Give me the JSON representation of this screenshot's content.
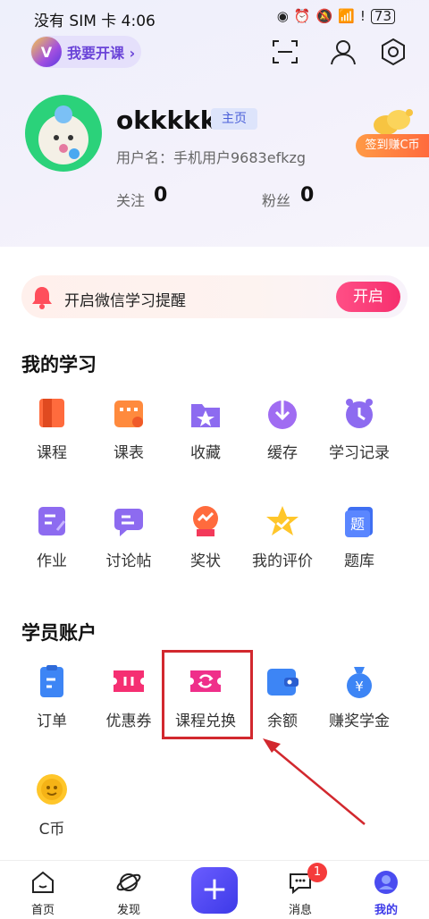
{
  "status_bar": {
    "carrier": "没有 SIM 卡 4:06",
    "battery": "73"
  },
  "header": {
    "teach_label": "我要开课 ›",
    "teach_logo": "V"
  },
  "profile": {
    "username": "okkkkk",
    "home_tag": "主页",
    "user_id": "用户名：手机用户9683efkzg",
    "follow_label": "关注",
    "follow_count": "0",
    "fans_label": "粉丝",
    "fans_count": "0",
    "signin_label": "签到赚C币"
  },
  "reminder": {
    "text": "开启微信学习提醒",
    "button": "开启"
  },
  "my_learning": {
    "title": "我的学习",
    "items": [
      {
        "label": "课程",
        "icon": "book-icon"
      },
      {
        "label": "课表",
        "icon": "calendar-icon"
      },
      {
        "label": "收藏",
        "icon": "star-folder-icon"
      },
      {
        "label": "缓存",
        "icon": "download-icon"
      },
      {
        "label": "学习记录",
        "icon": "clock-icon"
      },
      {
        "label": "作业",
        "icon": "homework-icon"
      },
      {
        "label": "讨论帖",
        "icon": "discussion-icon"
      },
      {
        "label": "奖状",
        "icon": "medal-icon"
      },
      {
        "label": "我的评价",
        "icon": "review-star-icon"
      },
      {
        "label": "题库",
        "icon": "question-bank-icon"
      }
    ]
  },
  "student_account": {
    "title": "学员账户",
    "items": [
      {
        "label": "订单",
        "icon": "order-icon"
      },
      {
        "label": "优惠券",
        "icon": "coupon-icon"
      },
      {
        "label": "课程兑换",
        "icon": "exchange-icon"
      },
      {
        "label": "余额",
        "icon": "wallet-icon"
      },
      {
        "label": "赚奖学金",
        "icon": "money-bag-icon"
      },
      {
        "label": "C币",
        "icon": "coin-icon"
      }
    ]
  },
  "tabbar": {
    "home": "首页",
    "discover": "发现",
    "plus": "+",
    "messages": "消息",
    "messages_badge": "1",
    "mine": "我的"
  },
  "colors": {
    "accent": "#5b3be0",
    "pink": "#f62f6e",
    "highlight_box": "#d2282e"
  }
}
